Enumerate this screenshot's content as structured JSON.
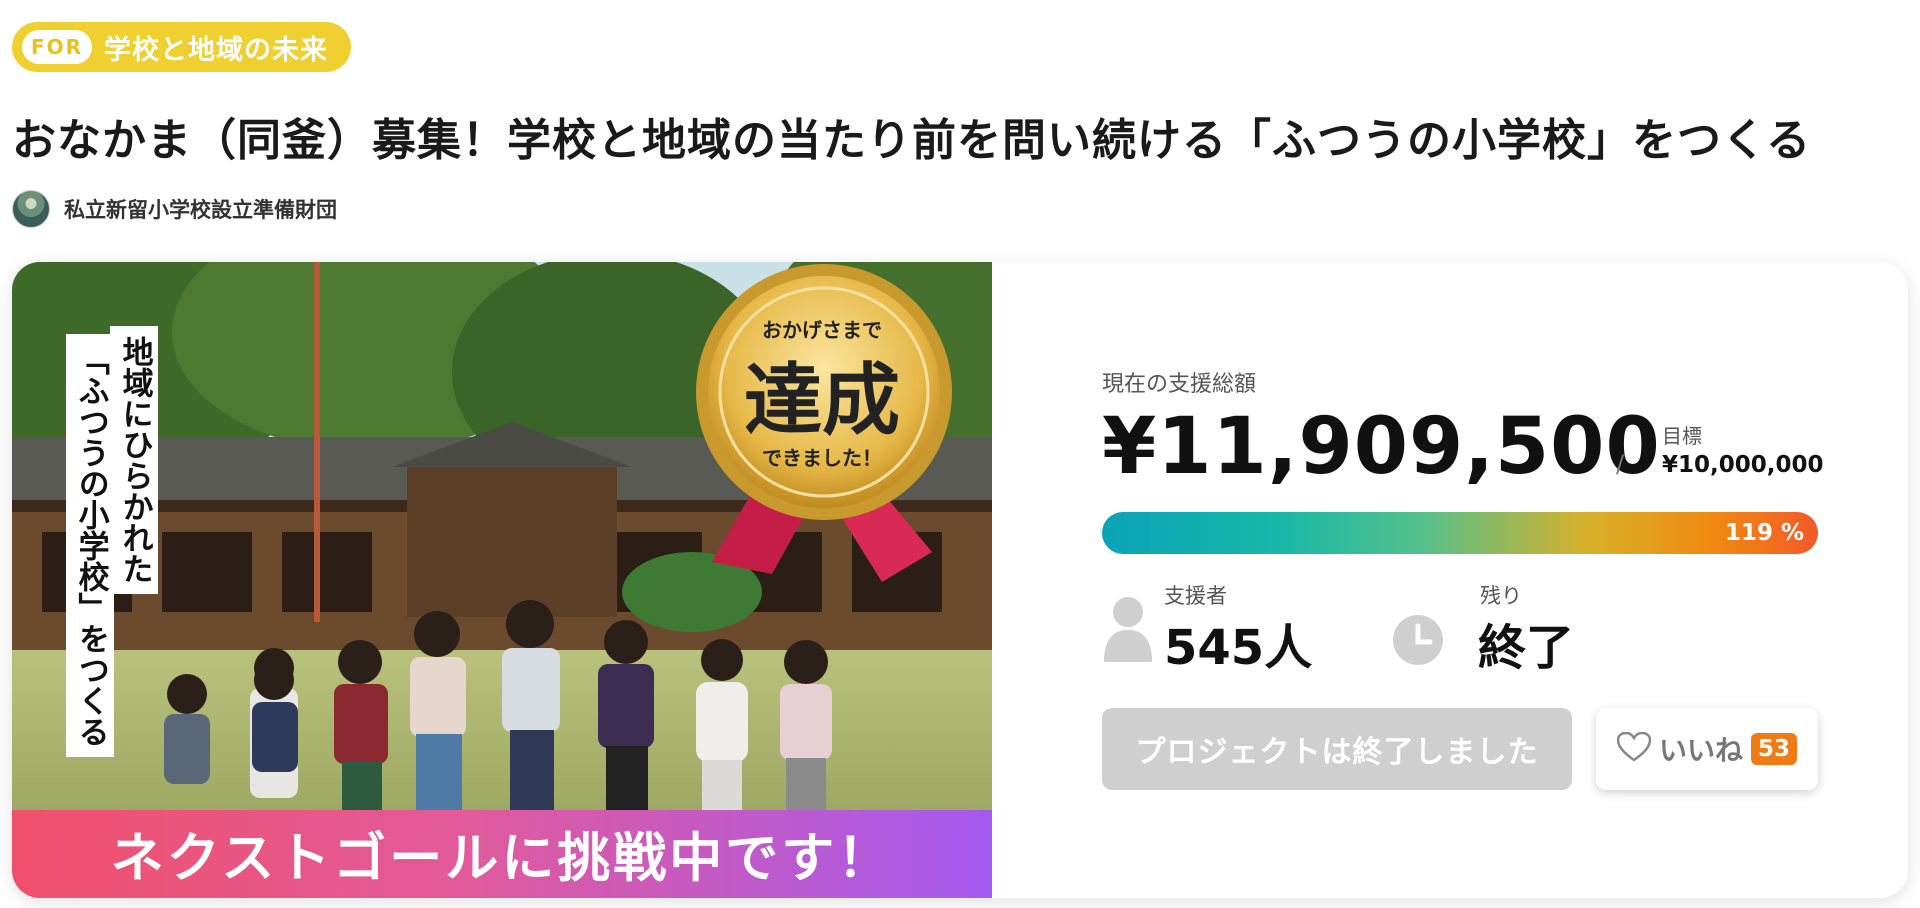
{
  "category": {
    "badge": "FOR",
    "label": "学校と地域の未来"
  },
  "project": {
    "title": "おなかま（同釜）募集！学校と地域の当たり前を問い続ける「ふつうの小学校」をつくる",
    "owner": "私立新留小学校設立準備財団"
  },
  "hero": {
    "vertical_text_1": "地域にひらかれた",
    "vertical_text_2": "「ふつうの小学校」をつくる",
    "medal_top": "おかげさまで",
    "medal_main": "達成",
    "medal_bottom": "できました！",
    "banner": "ネクストゴールに挑戦中です！"
  },
  "funding": {
    "current_label": "現在の支援総額",
    "amount": "¥11,909,500",
    "separator": "/",
    "goal_label": "目標",
    "goal_amount": "¥10,000,000",
    "progress_text": "119 %",
    "progress_fraction": 1.0
  },
  "stats": {
    "supporters_label": "支援者",
    "supporters_value": "545人",
    "remaining_label": "残り",
    "remaining_value": "終了"
  },
  "actions": {
    "ended_label": "プロジェクトは終了しました",
    "like_label": "いいね",
    "like_count": "53"
  },
  "colors": {
    "tag_yellow": "#f0d030",
    "like_orange": "#f07a14",
    "button_disabled": "#cfcfcf"
  },
  "icons": {
    "supporters": "person-icon",
    "remaining": "clock-icon",
    "like": "heart-icon"
  }
}
